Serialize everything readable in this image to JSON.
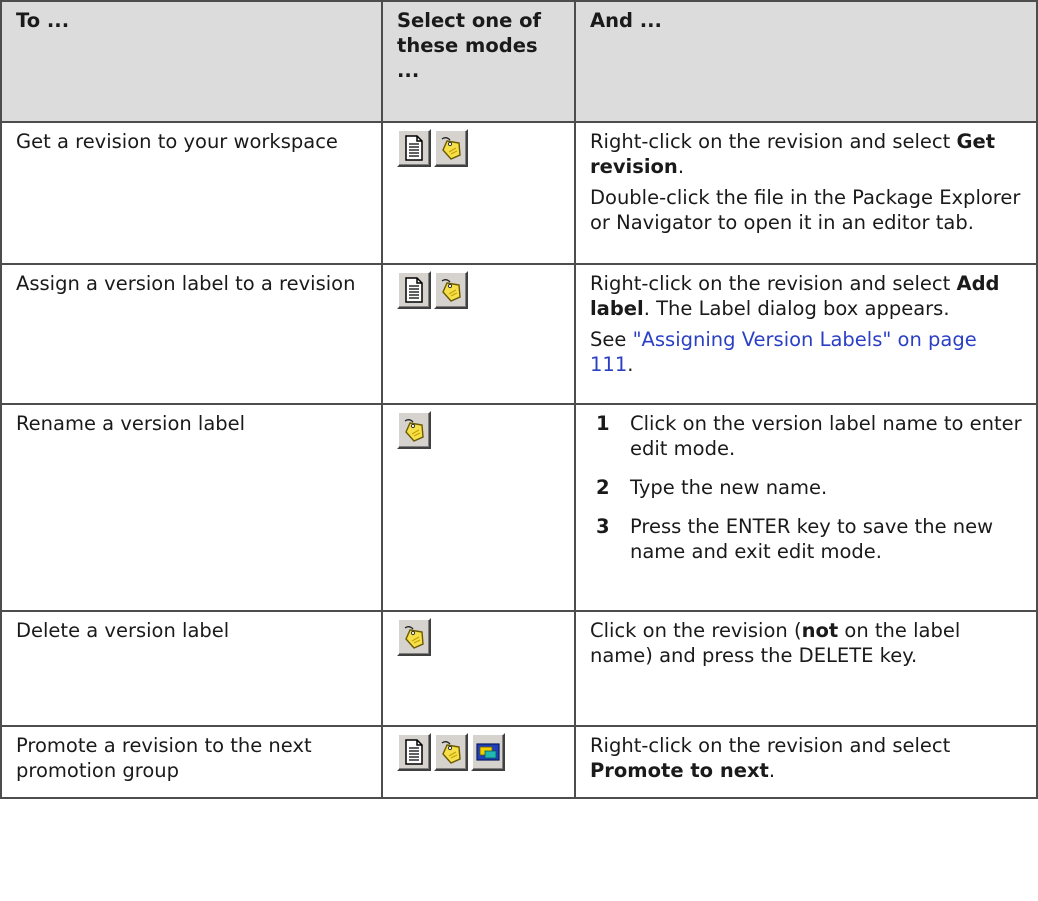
{
  "table": {
    "headers": [
      "To ...",
      "Select one of these modes ...",
      "And ..."
    ],
    "rows": [
      {
        "task": "Get a revision to your workspace",
        "p1_pre": "Right-click on the revision and select ",
        "p1_bold": "Get revision",
        "p1_post": ".",
        "p2": "Double-click the file in the Package Explorer or Navigator to open it in an editor tab."
      },
      {
        "task": "Assign a version label to a revision",
        "p1_pre": "Right-click on the revision and select ",
        "p1_bold": "Add label",
        "p1_post": ". The Label dialog box appears.",
        "p2_pre": "See ",
        "p2_link": "\"Assigning Version Labels\" on page 111",
        "p2_post": "."
      },
      {
        "task": "Rename a version label",
        "steps": [
          {
            "num": "1",
            "text": "Click on the version label name to enter edit mode."
          },
          {
            "num": "2",
            "text": "Type the new name."
          },
          {
            "num": "3",
            "text": "Press the ENTER key to save the new name and exit edit mode."
          }
        ]
      },
      {
        "task": "Delete a version label",
        "p1_pre": "Click on the revision (",
        "p1_bold": "not",
        "p1_post": " on the label name) and press the DELETE key."
      },
      {
        "task": "Promote a revision to the next promotion group",
        "p1_pre": "Right-click on the revision and select ",
        "p1_bold": "Promote to next",
        "p1_post": "."
      }
    ]
  },
  "icons": {
    "document": "document-icon",
    "label_tag": "label-tag-icon",
    "promotion": "promotion-group-icon"
  },
  "colors": {
    "header_bg": "#dcdcdc",
    "border": "#4d4d4d",
    "link": "#2b3fc4",
    "tag_yellow": "#f6e04a",
    "promo_blue": "#1f3fbf"
  }
}
